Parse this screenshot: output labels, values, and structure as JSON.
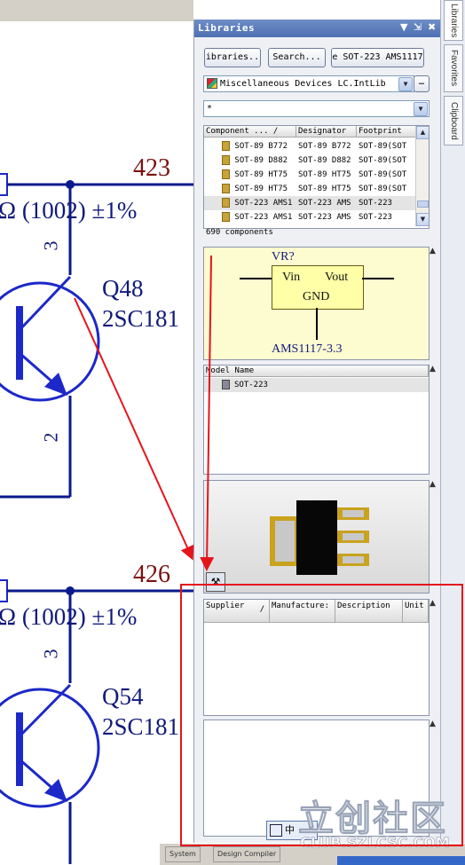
{
  "schematic": {
    "net_top": "423",
    "net_bottom": "426",
    "resistor_top": "Ω (1002) ±1%",
    "resistor_bottom": "Ω (1002) ±1%",
    "q1_designator": "Q48",
    "q1_part": "2SC181",
    "q2_designator": "Q54",
    "q2_part": "2SC181",
    "pin3": "3",
    "pin2": "2",
    "pin3b": "3",
    "colors": {
      "wire": "#0a1a8c",
      "net_label": "#7b1010",
      "part_text": "#111a7a",
      "symbol": "#1c28c8"
    }
  },
  "panel": {
    "title": "Libraries",
    "title_buttons": {
      "menu": "▼",
      "pin": "⇲",
      "close": "✖"
    },
    "buttons": {
      "libraries": "ibraries..",
      "search": "Search...",
      "place": "e SOT-223 AMS1117"
    },
    "library_select": "Miscellaneous Devices LC.IntLib",
    "filter_value": "*",
    "table": {
      "columns": [
        "Component ... /",
        "Designator",
        "Footprint"
      ],
      "rows": [
        {
          "component": "SOT-89 B772",
          "designator": "SOT-89 B772",
          "footprint": "SOT-89(SOT"
        },
        {
          "component": "SOT-89 D882",
          "designator": "SOT-89 D882",
          "footprint": "SOT-89(SOT"
        },
        {
          "component": "SOT-89 HT75",
          "designator": "SOT-89 HT75",
          "footprint": "SOT-89(SOT"
        },
        {
          "component": "SOT-89 HT75",
          "designator": "SOT-89 HT75",
          "footprint": "SOT-89(SOT"
        },
        {
          "component": "SOT-223 AMS1",
          "designator": "SOT-223 AMS",
          "footprint": "SOT-223",
          "selected": true
        },
        {
          "component": "SOT-223 AMS1",
          "designator": "SOT-223 AMS",
          "footprint": "SOT-223"
        }
      ]
    },
    "count": "690 components",
    "preview": {
      "designator": "VR?",
      "pin_in": "Vin",
      "pin_out": "Vout",
      "pin_gnd": "GND",
      "value": "AMS1117-3.3"
    },
    "models": {
      "header": "Model Name",
      "item": "SOT-223"
    },
    "supplier": {
      "columns": [
        "Supplier",
        "/",
        "Manufacture:",
        "Description",
        "Unit"
      ]
    }
  },
  "side_tabs": [
    "Libraries",
    "Favorites",
    "Clipboard"
  ],
  "taskbar": {
    "system": "System",
    "design_compiler": "Design Compiler",
    "ime": "中"
  },
  "watermark": {
    "logo": "立创社区",
    "url": "CLUB.SZLCSC.COM"
  }
}
